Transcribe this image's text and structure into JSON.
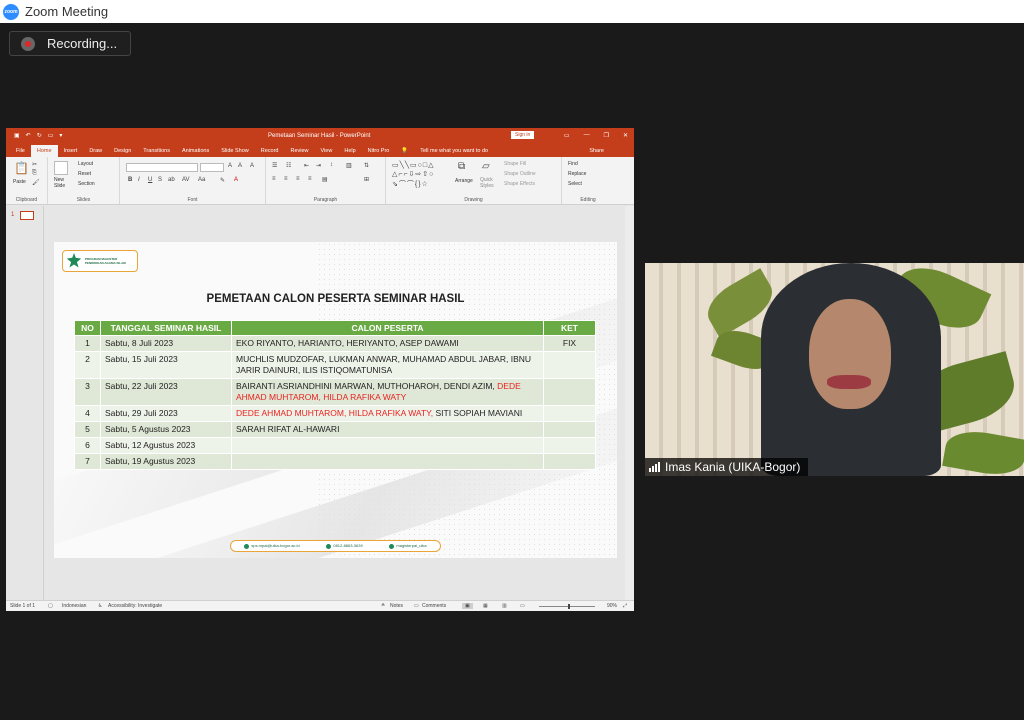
{
  "window": {
    "title": "Zoom Meeting",
    "logo_text": "zoom"
  },
  "recording": {
    "label": "Recording..."
  },
  "ppt": {
    "doc_title": "Pemetaan Seminar Hasil  -  PowerPoint",
    "sign_in": "Sign in",
    "tabs": [
      "File",
      "Home",
      "Insert",
      "Draw",
      "Design",
      "Transitions",
      "Animations",
      "Slide Show",
      "Record",
      "Review",
      "View",
      "Help",
      "Nitro Pro"
    ],
    "tell_me": "Tell me what you want to do",
    "share": "Share",
    "ribbon": {
      "paste": "Paste",
      "new_slide": "New Slide",
      "layout": "Layout",
      "reset": "Reset",
      "section": "Section",
      "arrange": "Arrange",
      "quick_styles": "Quick Styles",
      "shape_fill": "Shape Fill",
      "shape_outline": "Shape Outline",
      "shape_effects": "Shape Effects",
      "find": "Find",
      "replace": "Replace",
      "select": "Select",
      "groups": [
        "Clipboard",
        "Slides",
        "Font",
        "Paragraph",
        "Drawing",
        "Editing"
      ]
    },
    "thumb_number": "1",
    "status": {
      "slide": "Slide 1 of 1",
      "language": "Indonesian",
      "accessibility": "Accessibility: Investigate",
      "notes": "Notes",
      "comments": "Comments",
      "zoom": "90%"
    }
  },
  "slide": {
    "logo_text_1": "PROGRAM MAGISTER",
    "logo_text_2": "PENDIDIKAN AGAMA ISLAM",
    "title": "PEMETAAN CALON PESERTA SEMINAR HASIL",
    "headers": [
      "NO",
      "TANGGAL SEMINAR HASIL",
      "CALON PESERTA",
      "KET"
    ],
    "rows": [
      {
        "no": "1",
        "date": "Sabtu, 8 Juli 2023",
        "peserta": "EKO RIYANTO, HARIANTO, HERIYANTO, ASEP DAWAMI",
        "peserta_red": "",
        "peserta_after": "",
        "ket": "FIX"
      },
      {
        "no": "2",
        "date": "Sabtu, 15 Juli 2023",
        "peserta": "MUCHLIS MUDZOFAR, LUKMAN ANWAR, MUHAMAD ABDUL JABAR, IBNU JARIR DAINURI, ILIS ISTIQOMATUNISA",
        "peserta_red": "",
        "peserta_after": "",
        "ket": ""
      },
      {
        "no": "3",
        "date": "Sabtu, 22 Juli 2023",
        "peserta": "BAIRANTI ASRIANDHINI MARWAN, MUTHOHAROH, DENDI AZIM, ",
        "peserta_red": "DEDE AHMAD MUHTAROM, HILDA RAFIKA WATY",
        "peserta_after": "",
        "ket": ""
      },
      {
        "no": "4",
        "date": "Sabtu, 29 Juli 2023",
        "peserta": "",
        "peserta_red": "DEDE AHMAD MUHTAROM, HILDA RAFIKA WATY,",
        "peserta_after": " SITI SOPIAH MAVIANI",
        "ket": ""
      },
      {
        "no": "5",
        "date": "Sabtu, 5 Agustus 2023",
        "peserta": "SARAH RIFAT AL-HAWARI",
        "peserta_red": "",
        "peserta_after": "",
        "ket": ""
      },
      {
        "no": "6",
        "date": "Sabtu, 12 Agustus 2023",
        "peserta": "",
        "peserta_red": "",
        "peserta_after": "",
        "ket": ""
      },
      {
        "no": "7",
        "date": "Sabtu, 19 Agustus 2023",
        "peserta": "",
        "peserta_red": "",
        "peserta_after": "",
        "ket": ""
      }
    ],
    "footer": [
      "sps.mpai@uika-bogor.ac.id",
      "0812-8863-3639",
      "magisterpai_uika"
    ]
  },
  "participant": {
    "name": "Imas Kania (UIKA-Bogor)"
  },
  "colors": {
    "ppt_accent": "#c43e1c",
    "table_header": "#6aaa45",
    "highlight_red": "#e8231f"
  }
}
